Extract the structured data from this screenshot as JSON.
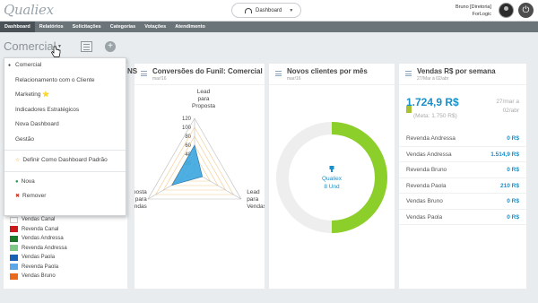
{
  "app": {
    "logo": "Qualiex"
  },
  "header": {
    "dashboard_select": "Dashboard",
    "user_name": "Bruno [Diretoria]",
    "user_company": "ForLogic"
  },
  "nav": {
    "items": [
      "Dashboard",
      "Relatórios",
      "Solicitações",
      "Categorias",
      "Votações",
      "Atendimento"
    ]
  },
  "page": {
    "title": "Comercial"
  },
  "menu": {
    "items": [
      {
        "label": "Comercial",
        "selected": true
      },
      {
        "label": "Relacionamento com o Cliente"
      },
      {
        "label": "Marketing ⭐"
      },
      {
        "label": "Indicadores Estratégicos"
      },
      {
        "label": "Nova Dashboard"
      },
      {
        "label": "Gestão"
      }
    ],
    "default_label": "Definir Como Dashboard Padrão",
    "new_label": "Nova",
    "remove_label": "Remover"
  },
  "legend": {
    "items": [
      {
        "label": "Vendas Canal",
        "color": "#ffffff"
      },
      {
        "label": "Revenda Canal",
        "color": "#cc1a1a"
      },
      {
        "label": "Vendas Andressa",
        "color": "#1a7a2a"
      },
      {
        "label": "Revenda Andressa",
        "color": "#7ec885"
      },
      {
        "label": "Vendas Paola",
        "color": "#1a62b8"
      },
      {
        "label": "Revenda Paola",
        "color": "#5aa8e8"
      },
      {
        "label": "Vendas Bruno",
        "color": "#e86a1a"
      }
    ]
  },
  "funnel": {
    "title": "Conversões do Funil: Comercial",
    "subtitle": "mar/16",
    "left_clip": "NS"
  },
  "clients": {
    "title": "Novos clientes por mês",
    "subtitle": "mar/16",
    "center_name": "Qualiex",
    "center_value": "8 Und"
  },
  "sales": {
    "title": "Vendas R$ por semana",
    "subtitle": "27/Mar à 02/abr",
    "kpi": "1.724,9 R$",
    "meta": "(Meta: 1.750 R$)",
    "date_from": "27/mar a",
    "date_to": "02/abr",
    "rows": [
      {
        "label": "Revenda Andressa",
        "value": "0 R$"
      },
      {
        "label": "Vendas Andressa",
        "value": "1.514,9 R$"
      },
      {
        "label": "Revenda Bruno",
        "value": "0 R$"
      },
      {
        "label": "Revenda Paola",
        "value": "210 R$"
      },
      {
        "label": "Vendas Bruno",
        "value": "0 R$"
      },
      {
        "label": "Vendas Paola",
        "value": "0 R$"
      }
    ]
  },
  "chart_data": [
    {
      "type": "radar",
      "title": "Conversões do Funil: Comercial",
      "axes": [
        "Lead para Proposta",
        "Lead para Vendas",
        "Proposta para Vendas"
      ],
      "ticks": [
        20,
        40,
        60,
        80,
        100,
        120
      ],
      "rlim": [
        0,
        120
      ],
      "series": [
        {
          "values": [
            60,
            20,
            58
          ],
          "color": "#3ba6e0"
        }
      ]
    },
    {
      "type": "donut",
      "title": "Novos clientes por mês",
      "slices": [
        {
          "label": "Qualiex",
          "value": 8,
          "color": "#8ccf2a"
        }
      ],
      "share_of_ring": 0.5
    }
  ]
}
